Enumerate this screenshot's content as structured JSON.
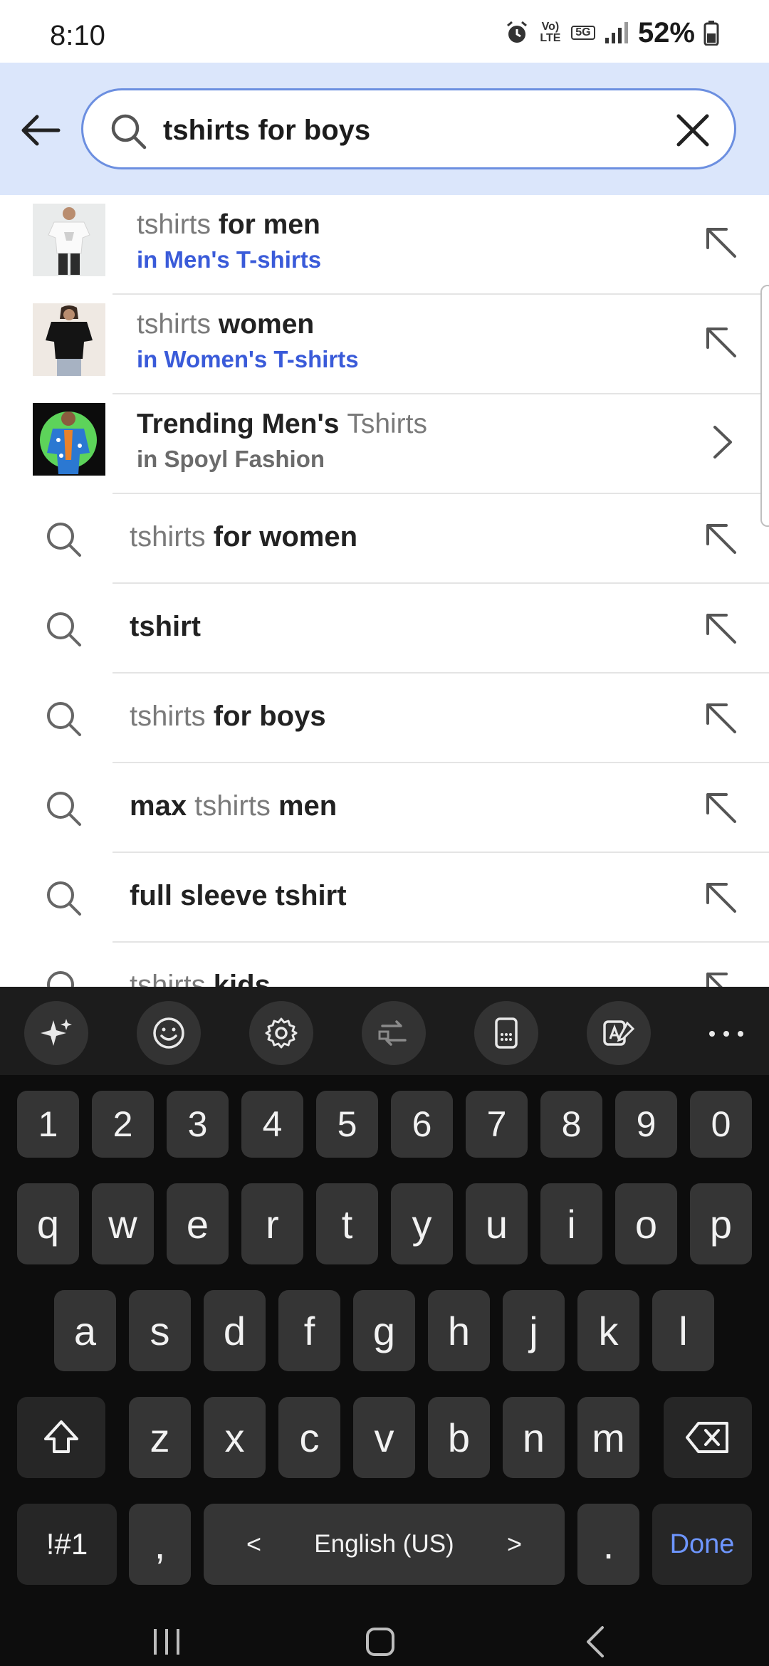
{
  "status": {
    "time": "8:10",
    "battery": "52%",
    "icons": [
      "alarm-icon",
      "volte-icon",
      "5g-icon",
      "signal-icon",
      "battery-icon"
    ],
    "volte_label": "Vo) LTE",
    "net_label": "5G"
  },
  "search": {
    "query": "tshirts for boys",
    "placeholder": ""
  },
  "suggestions": [
    {
      "type": "category",
      "muted": "tshirts ",
      "bold": "for men",
      "sub": "in Men's T-shirts",
      "thumb": "men-tshirt-image"
    },
    {
      "type": "category",
      "muted": "tshirts ",
      "bold": "women",
      "sub": "in Women's T-shirts",
      "thumb": "women-tshirt-image"
    },
    {
      "type": "brand",
      "bold": "Trending Men's ",
      "muted": "Tshirts",
      "sub": "in Spoyl Fashion",
      "thumb": "trending-tshirt-image"
    },
    {
      "type": "query",
      "muted": "tshirts ",
      "bold": "for women"
    },
    {
      "type": "query",
      "muted": "",
      "bold": "tshirt"
    },
    {
      "type": "query",
      "muted": "tshirts ",
      "bold": "for boys"
    },
    {
      "type": "query",
      "pre_bold": "max ",
      "muted": "tshirts ",
      "bold": "men"
    },
    {
      "type": "query",
      "muted": "",
      "bold": "full sleeve tshirt"
    },
    {
      "type": "query",
      "muted": "tshirts ",
      "bold": "kids"
    }
  ],
  "keyboard": {
    "toolbar": [
      "ai-sparkle-icon",
      "emoji-icon",
      "settings-icon",
      "translate-icon",
      "keyboard-mode-icon",
      "text-edit-icon",
      "more-icon"
    ],
    "row_numbers": [
      "1",
      "2",
      "3",
      "4",
      "5",
      "6",
      "7",
      "8",
      "9",
      "0"
    ],
    "row1": [
      "q",
      "w",
      "e",
      "r",
      "t",
      "y",
      "u",
      "i",
      "o",
      "p"
    ],
    "row2": [
      "a",
      "s",
      "d",
      "f",
      "g",
      "h",
      "j",
      "k",
      "l"
    ],
    "row3": [
      "z",
      "x",
      "c",
      "v",
      "b",
      "n",
      "m"
    ],
    "symbols_label": "!#1",
    "comma_label": ",",
    "space_label": "English (US)",
    "space_left": "<",
    "space_right": ">",
    "period_label": ".",
    "done_label": "Done"
  },
  "colors": {
    "header_bg": "#dbe6fb",
    "accent": "#3a5bd9",
    "keyboard_bg": "#0d0d0d",
    "key_bg": "#353535"
  }
}
